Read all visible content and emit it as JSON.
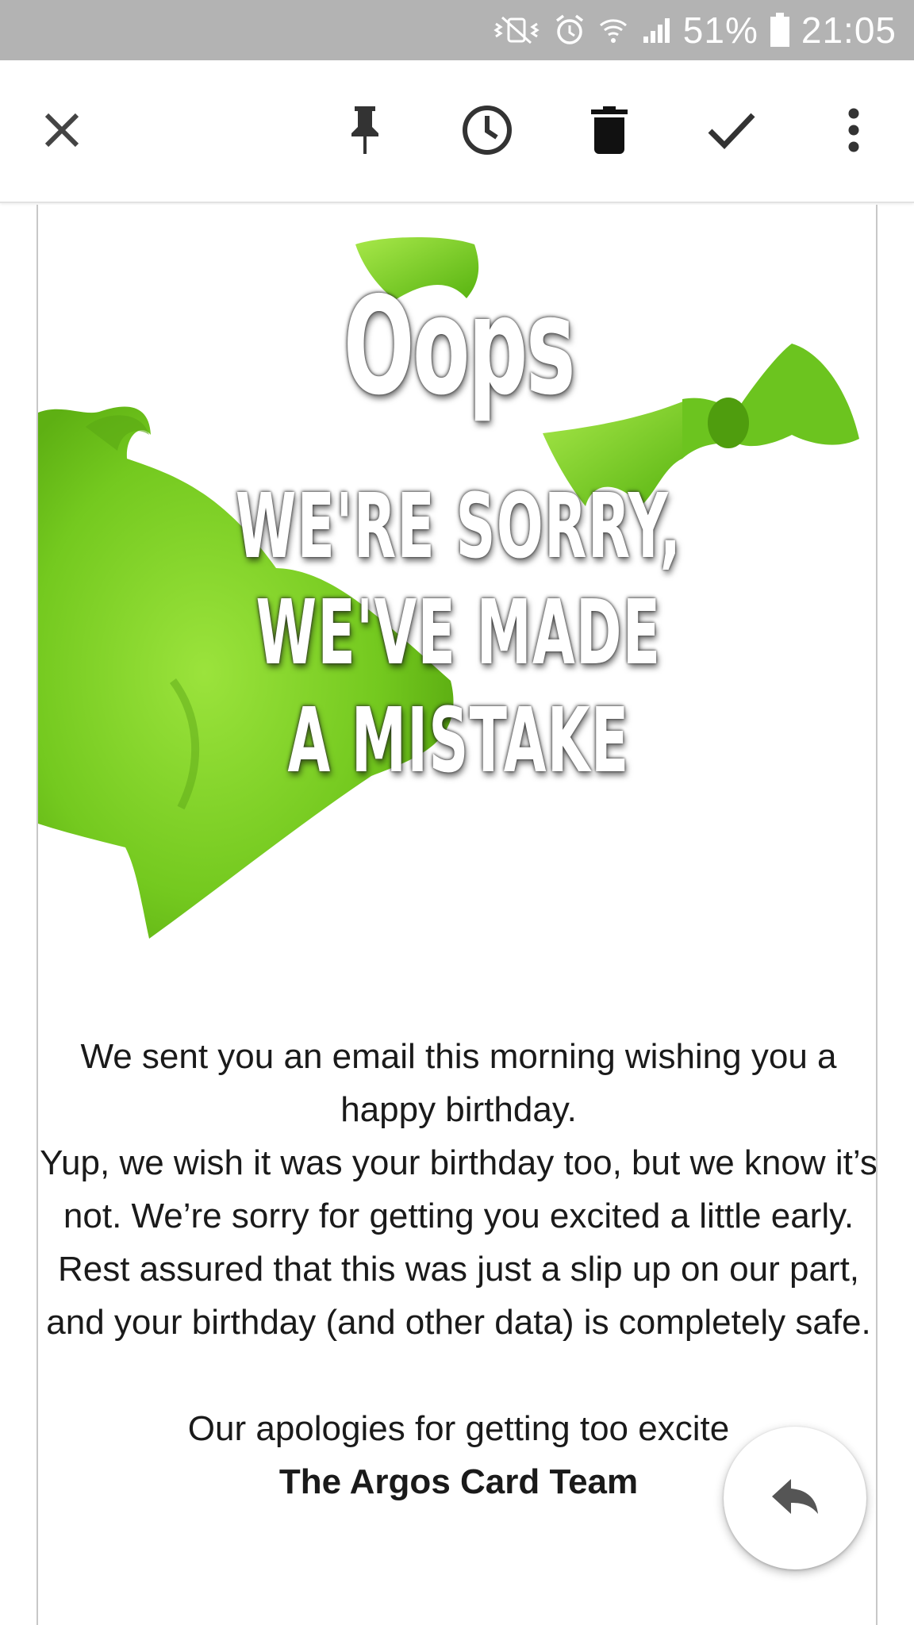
{
  "status_bar": {
    "battery_percent": "51%",
    "time": "21:05",
    "icons": [
      "vibrate-mute-icon",
      "alarm-icon",
      "wifi-icon",
      "signal-icon",
      "battery-icon"
    ]
  },
  "toolbar": {
    "actions": [
      "close-icon",
      "pin-icon",
      "snooze-icon",
      "delete-icon",
      "done-icon",
      "more-icon"
    ]
  },
  "email": {
    "hero": {
      "title": "Oops",
      "headline_line1": "WE'RE SORRY,",
      "headline_line2": "WE'VE MADE",
      "headline_line3": "A MISTAKE"
    },
    "paragraph1": "We sent you an email this morning wishing you a happy birthday.",
    "paragraph2": "Yup, we wish it was your birthday too, but we know it’s not. We’re sorry for getting you excited a little early. Rest assured that this was just a slip up on our part, and your birthday (and other data) is completely safe.",
    "closing": "Our apologies for getting too excite",
    "signature": "The Argos Card Team"
  },
  "fab": {
    "icon": "reply-icon"
  },
  "colors": {
    "status_bar_bg": "#b3b3b3",
    "balloon_green": "#7ed321",
    "text": "#1a1a1a"
  }
}
